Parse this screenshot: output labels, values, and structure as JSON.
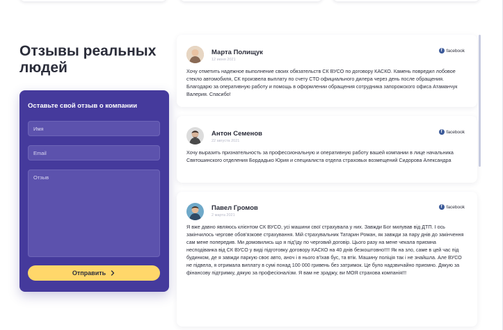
{
  "title": "Отзывы реальных людей",
  "form": {
    "heading": "Оставьте свой отзыв о компании",
    "name_placeholder": "Имя",
    "email_placeholder": "Email",
    "review_placeholder": "Отзыв",
    "submit_label": "Отправить"
  },
  "reviews": [
    {
      "name": "Марта Полищук",
      "date": "12 июня 2021",
      "source": "facebook",
      "text": "Хочу отметить надежное выполнение своих обязательств СК ВУСО по договору КАСКО. Камень повредил лобовое стекло автомобиля, СК произвела выплату по счету СТО официального дилера через день после обращения. Благодарю за оперативную работу и помощь в оформлении обращения сотрудника запорожского офиса Атаманчук Валерия. Спасибо!"
    },
    {
      "name": "Антон Семенов",
      "date": "22 августа 2021",
      "source": "facebook",
      "text": "Хочу выразить признательность за профессиональную и оперативную работу вашей компании в лице начальника Святошинского отделения Бордадько Юрия и специалиста отдела страховых возмещений Сидорова Александра"
    },
    {
      "name": "Павел Громов",
      "date": "2 марта 2021",
      "source": "facebook",
      "text": "Я вже давно являюсь клієнтом СК ВУСО, усі машини свої страхувала у них. Завжди Бог милував від ДТП. І ось закінчилось чергове обов'язкове страхування. Мій страхувальник Татарин Роман, як завжди за пару днів до закінчення сам мене попередив. Ми домовились що я під'їду по черговий договір. Цього разу на мене чекала приємна несподіванка від СК ВУСО у виді підготовку договору КАСКО на 40 днів безкоштовно!!!! Як на зло, саме в цей час під будинком, де я завжди паркую своє авто, аноч і в нього в'їхав бус, та втік. Машину поліція так і не знайшла. Але ВУСО не підвела, я отримала виплату в сумі понад 100 000 гривень без затримок. Це було надзвичайно приємно. Дякую за фінансову підтримку, дякую за професіоналізм. Я вам не зраджу, ви МОЯ страхова компанія!!!"
    }
  ]
}
